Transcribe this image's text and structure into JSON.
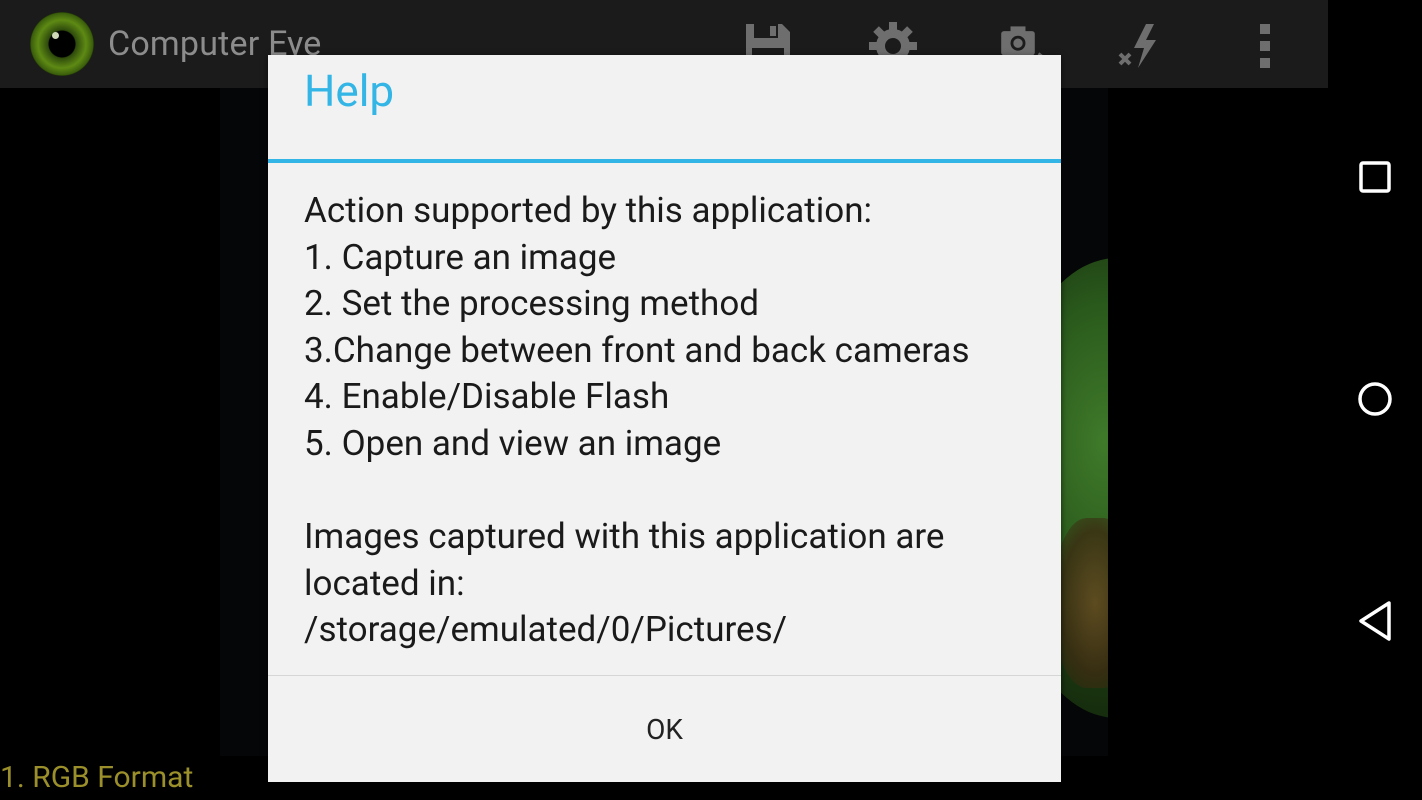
{
  "app": {
    "title": "Computer Eye"
  },
  "actionbar": {
    "icons": [
      "save-icon",
      "settings-icon",
      "switch-camera-icon",
      "flash-off-icon",
      "overflow-menu-icon"
    ]
  },
  "status": {
    "format_text": "1. RGB Format"
  },
  "dialog": {
    "title": "Help",
    "lines": [
      "Action supported by this application:",
      "1. Capture an image",
      "2. Set the processing method",
      "3.Change between front and back cameras",
      "4. Enable/Disable Flash",
      "5. Open and view an image"
    ],
    "location_intro": "Images captured with this application are located in:",
    "location_path": "/storage/emulated/0/Pictures/",
    "ok_label": "OK"
  },
  "navbar": {
    "icons": [
      "recents-icon",
      "home-icon",
      "back-icon"
    ]
  },
  "colors": {
    "accent": "#33b5e5",
    "dialog_bg": "#f2f2f2",
    "actionbar_bg": "#1b1b1b",
    "status_text": "#9a8f2a"
  }
}
